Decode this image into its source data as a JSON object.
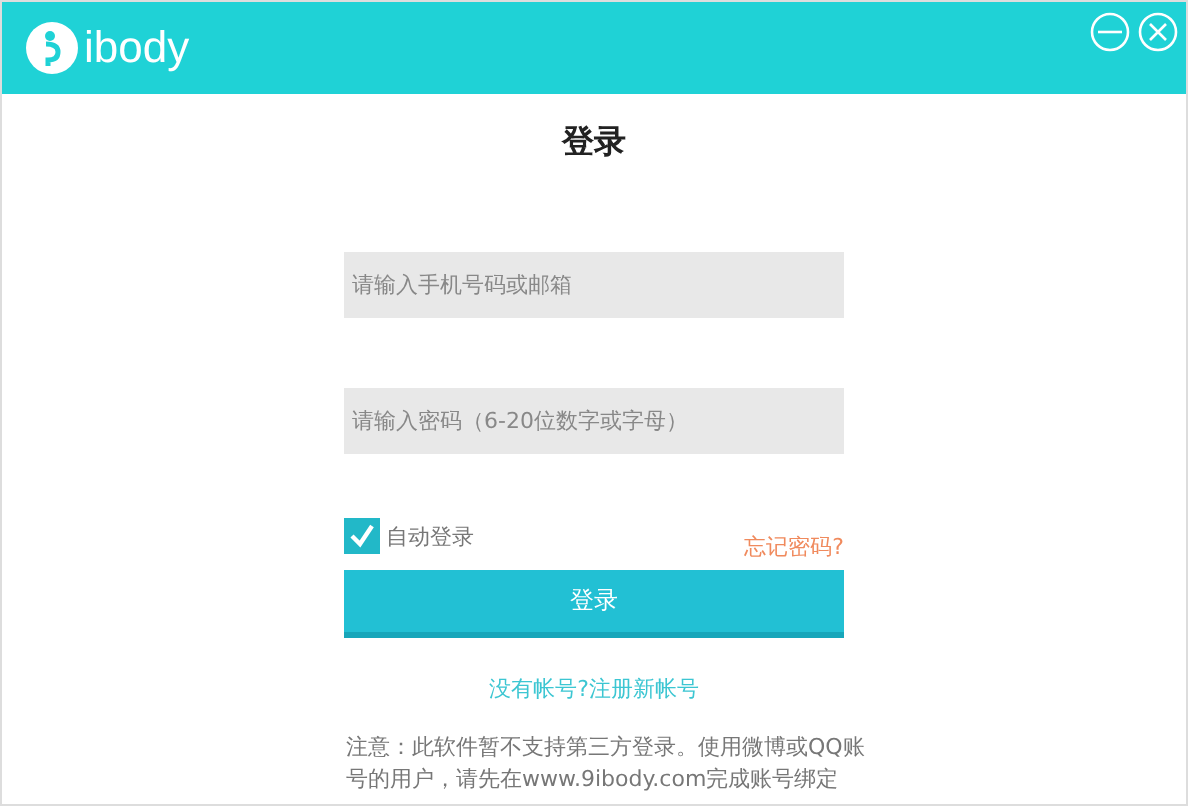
{
  "header": {
    "logo": "ibody"
  },
  "title": "登录",
  "fields": [
    {
      "placeholder": "请输入手机号码或邮箱"
    },
    {
      "placeholder": "请输入密码（6-20位数字或字母）"
    }
  ],
  "auto_login": {
    "label": "自动登录",
    "checked": true
  },
  "forgot_link": "忘记密码?",
  "login_button": "登录",
  "register_link": "没有帐号?注册新帐号",
  "note": "注意：此软件暂不支持第三方登录。使用微博或QQ账号的用户，请先在www.9ibody.com完成账号绑定"
}
